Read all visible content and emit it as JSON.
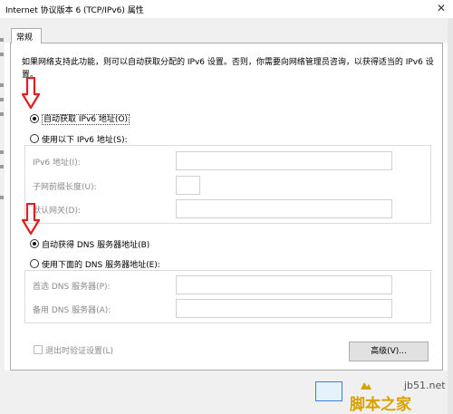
{
  "window": {
    "title": "Internet 协议版本 6 (TCP/IPv6) 属性",
    "close_glyph": "✕"
  },
  "tabs": [
    {
      "label": "常规",
      "selected": true
    }
  ],
  "description": "如果网络支持此功能，则可以自动获取分配的 IPv6 设置。否则，你需要向网络管理员咨询，以获得适当的 IPv6 设置。",
  "ip": {
    "auto_label": "自动获取 IPv6 地址(O)",
    "auto_selected": true,
    "manual_label": "使用以下 IPv6 地址(S):",
    "fields": [
      {
        "label": "IPv6 地址(I):",
        "value": ""
      },
      {
        "label": "子网前缀长度(U):",
        "value": ""
      },
      {
        "label": "默认网关(D):",
        "value": ""
      }
    ]
  },
  "dns": {
    "auto_label": "自动获得 DNS 服务器地址(B)",
    "auto_selected": true,
    "manual_label": "使用下面的 DNS 服务器地址(E):",
    "fields": [
      {
        "label": "首选 DNS 服务器(P):",
        "value": ""
      },
      {
        "label": "备用 DNS 服务器(A):",
        "value": ""
      }
    ]
  },
  "validate_checkbox": {
    "label": "退出时验证设置(L)",
    "checked": false,
    "enabled": false
  },
  "advanced_button": "高级(V)...",
  "watermark": {
    "site": "jb51.net",
    "name": "脚本之家"
  },
  "colors": {
    "annotation_arrow": "#e02020",
    "watermark_gold": "#d9a100"
  }
}
